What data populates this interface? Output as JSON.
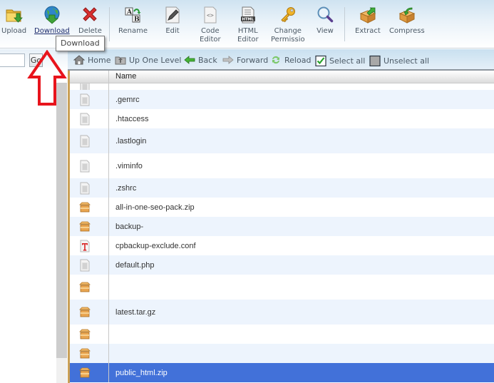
{
  "toolbar": {
    "buttons": [
      {
        "id": "upload",
        "label": "Upload",
        "icon": "upload-folder-icon"
      },
      {
        "id": "download",
        "label": "Download",
        "icon": "download-globe-icon",
        "active": true
      },
      {
        "id": "delete",
        "label": "Delete",
        "icon": "delete-x-icon"
      },
      {
        "id": "rename",
        "label": "Rename",
        "icon": "rename-ab-icon"
      },
      {
        "id": "edit",
        "label": "Edit",
        "icon": "edit-pencil-icon"
      },
      {
        "id": "code-editor",
        "label_line1": "Code",
        "label_line2": "Editor",
        "icon": "code-editor-icon"
      },
      {
        "id": "html-editor",
        "label_line1": "HTML",
        "label_line2": "Editor",
        "icon": "html-editor-icon"
      },
      {
        "id": "change-permissions",
        "label_line1": "Change",
        "label_line2": "Permissio",
        "icon": "key-icon"
      },
      {
        "id": "view",
        "label": "View",
        "icon": "magnifier-icon"
      },
      {
        "id": "extract",
        "label": "Extract",
        "icon": "extract-box-icon"
      },
      {
        "id": "compress",
        "label": "Compress",
        "icon": "compress-box-icon"
      }
    ],
    "tooltip": "Download"
  },
  "left_panel": {
    "go_label": "Go",
    "path_value": ""
  },
  "navbar": {
    "home": "Home",
    "up_one_level": "Up One Level",
    "back": "Back",
    "forward": "Forward",
    "reload": "Reload",
    "select_all": "Select all",
    "unselect_all": "Unselect all"
  },
  "table": {
    "columns": [
      "Name"
    ],
    "rows": [
      {
        "name": ".gemrc",
        "type": "text",
        "selected": false
      },
      {
        "name": ".htaccess",
        "type": "text",
        "selected": false
      },
      {
        "name": ".lastlogin",
        "type": "text",
        "selected": false
      },
      {
        "name": ".viminfo",
        "type": "text",
        "selected": false
      },
      {
        "name": ".zshrc",
        "type": "text",
        "selected": false
      },
      {
        "name": "all-in-one-seo-pack.zip",
        "type": "archive",
        "selected": false
      },
      {
        "name": "backup-",
        "type": "archive",
        "selected": false
      },
      {
        "name": "cpbackup-exclude.conf",
        "type": "conf",
        "selected": false
      },
      {
        "name": "default.php",
        "type": "text",
        "selected": false
      },
      {
        "name": "",
        "type": "archive",
        "selected": false
      },
      {
        "name": "latest.tar.gz",
        "type": "archive",
        "selected": false
      },
      {
        "name": "",
        "type": "archive",
        "selected": false
      },
      {
        "name": "",
        "type": "archive",
        "selected": false
      },
      {
        "name": "public_html.zip",
        "type": "archive",
        "selected": true
      }
    ]
  },
  "colors": {
    "selection": "#4271d9",
    "row_alt": "#edf4fd",
    "annotation_arrow": "#e8141c"
  }
}
